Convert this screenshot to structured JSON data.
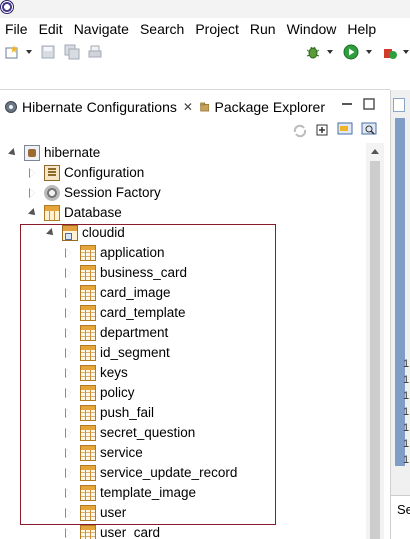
{
  "menubar": {
    "items": [
      "File",
      "Edit",
      "Navigate",
      "Search",
      "Project",
      "Run",
      "Window",
      "Help"
    ]
  },
  "toolbar": {
    "icons": [
      "new-wizard-icon",
      "save-icon",
      "save-all-icon",
      "print-icon",
      "debug-icon",
      "run-icon",
      "external-tools-icon"
    ]
  },
  "tabs": {
    "active": {
      "label": "Hibernate Configurations",
      "icon": "hibernate-config-icon"
    },
    "inactive": {
      "label": "Package Explorer",
      "icon": "package-explorer-icon"
    }
  },
  "tree": {
    "root": "hibernate",
    "children": [
      "Configuration",
      "Session Factory",
      "Database"
    ],
    "schema": "cloudid",
    "tables": [
      "application",
      "business_card",
      "card_image",
      "card_template",
      "department",
      "id_segment",
      "keys",
      "policy",
      "push_fail",
      "secret_question",
      "service",
      "service_update_record",
      "template_image",
      "user",
      "user_card"
    ]
  },
  "right_panel": {
    "line_numbers": [
      "1",
      "1",
      "1",
      "1",
      "1",
      "1",
      "1"
    ],
    "bottom_label": "Se"
  },
  "colors": {
    "highlight_border": "#8b1a2b",
    "editor_ruler": "#7f9dc6"
  }
}
